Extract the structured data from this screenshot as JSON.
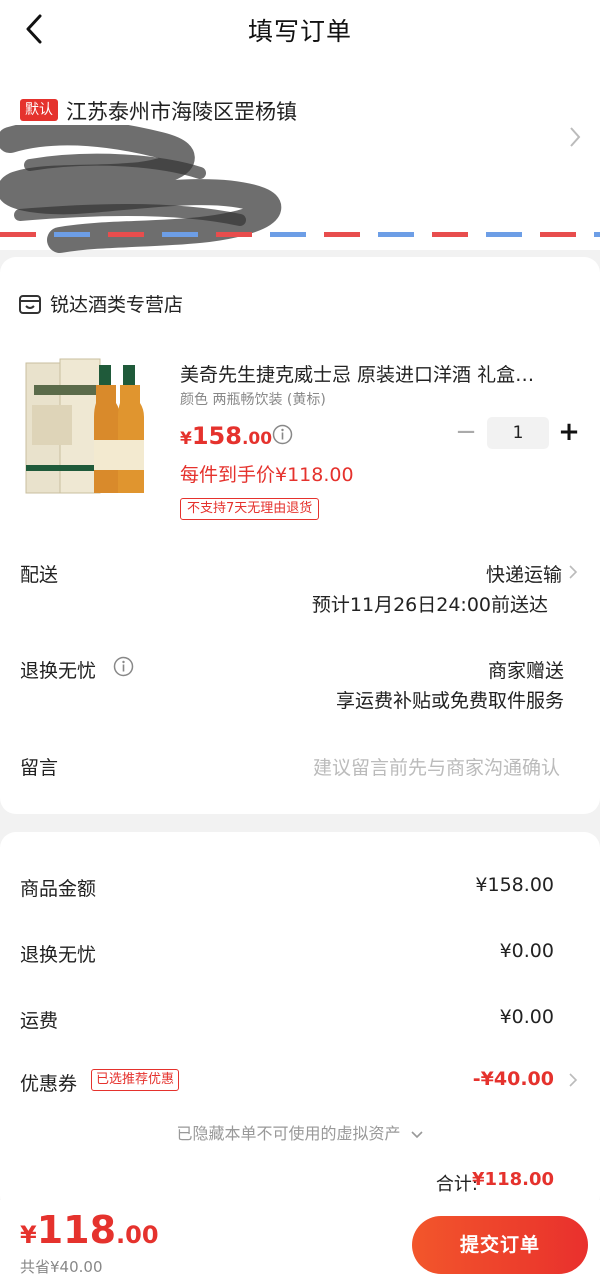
{
  "header": {
    "title": "填写订单"
  },
  "address": {
    "badge": "默认",
    "region": "江苏泰州市海陵区罡杨镇"
  },
  "store": {
    "name": "锐达酒类专营店",
    "product": {
      "title": "美奇先生捷克威士忌 原装进口洋酒 礼盒…",
      "variant": "颜色 两瓶畅饮装 (黄标)",
      "price_symbol": "¥",
      "price_int": "158",
      "price_dec": ".00",
      "quantity": "1",
      "final_price": "每件到手价¥118.00",
      "return_badge": "不支持7天无理由退货"
    },
    "delivery": {
      "label": "配送",
      "value": "快递运输",
      "eta": "预计11月26日24:00前送达"
    },
    "worry_free": {
      "label": "退换无忧",
      "value": "商家赠送",
      "sub": "享运费补贴或免费取件服务"
    },
    "message": {
      "label": "留言",
      "placeholder": "建议留言前先与商家沟通确认"
    }
  },
  "summary": {
    "goods_label": "商品金额",
    "goods_value": "¥158.00",
    "worry_label": "退换无忧",
    "worry_value": "¥0.00",
    "shipping_label": "运费",
    "shipping_value": "¥0.00",
    "coupon_label": "优惠券",
    "coupon_tag": "已选推荐优惠",
    "coupon_value": "-¥40.00",
    "hidden_note": "已隐藏本单不可使用的虚拟资产",
    "total_label": "合计:",
    "total_value": "¥118.00"
  },
  "bottom": {
    "price_symbol": "¥",
    "price_int": "118",
    "price_dec": ".00",
    "saved": "共省¥40.00",
    "submit": "提交订单"
  },
  "colors": {
    "accent": "#e5322d",
    "background": "#f2f2f2"
  }
}
